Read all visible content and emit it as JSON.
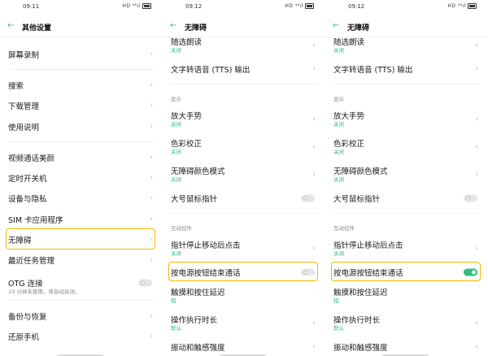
{
  "colors": {
    "accent": "#2dbe7d",
    "highlight": "#f5b800"
  },
  "panels": [
    {
      "time": "09:11",
      "status_icons": "HD ⁴⁶ıl",
      "title": "其他设置",
      "rows": [
        {
          "type": "item",
          "title": "屏幕录制",
          "control": "chevron"
        },
        {
          "type": "divider"
        },
        {
          "type": "item",
          "title": "搜索",
          "control": "chevron"
        },
        {
          "type": "item",
          "title": "下载管理",
          "control": "chevron"
        },
        {
          "type": "item",
          "title": "使用说明",
          "control": "chevron"
        },
        {
          "type": "divider"
        },
        {
          "type": "item",
          "title": "视频通话美颜",
          "control": "chevron"
        },
        {
          "type": "item",
          "title": "定时开关机",
          "control": "chevron"
        },
        {
          "type": "item",
          "title": "设备与隐私",
          "control": "chevron"
        },
        {
          "type": "item",
          "title": "SIM 卡应用程序",
          "control": "chevron"
        },
        {
          "type": "item",
          "title": "无障碍",
          "control": "chevron",
          "highlighted": true
        },
        {
          "type": "item",
          "title": "最近任务管理",
          "control": "chevron"
        },
        {
          "type": "item",
          "title": "OTG 连接",
          "subtitle": "10 分钟未使用，将自动关闭。",
          "subtitle_gray": true,
          "control": "toggle",
          "on": false
        },
        {
          "type": "divider"
        },
        {
          "type": "item",
          "title": "备份与恢复",
          "control": "chevron"
        },
        {
          "type": "item",
          "title": "还原手机",
          "control": "chevron"
        }
      ]
    },
    {
      "time": "09:12",
      "status_icons": "HD ⁴⁶ıl",
      "title": "无障碍",
      "rows": [
        {
          "type": "item",
          "title": "随选朗读",
          "subtitle": "关闭",
          "control": "chevron"
        },
        {
          "type": "item",
          "title": "文字转语音 (TTS) 输出",
          "control": "chevron"
        },
        {
          "type": "divider"
        },
        {
          "type": "section",
          "title": "显示"
        },
        {
          "type": "item",
          "title": "放大手势",
          "subtitle": "关闭",
          "control": "chevron"
        },
        {
          "type": "item",
          "title": "色彩校正",
          "subtitle": "关闭",
          "control": "chevron"
        },
        {
          "type": "item",
          "title": "无障碍颜色模式",
          "subtitle": "关闭",
          "control": "chevron"
        },
        {
          "type": "item",
          "title": "大号鼠标指针",
          "control": "toggle",
          "on": false
        },
        {
          "type": "divider"
        },
        {
          "type": "section",
          "title": "互动控件"
        },
        {
          "type": "item",
          "title": "指针停止移动后点击",
          "subtitle": "关闭",
          "control": "chevron"
        },
        {
          "type": "item",
          "title": "按电源按钮结束通话",
          "control": "toggle",
          "on": false,
          "highlighted": true
        },
        {
          "type": "item",
          "title": "触摸和按住延迟",
          "subtitle": "短",
          "control": "none"
        },
        {
          "type": "item",
          "title": "操作执行时长",
          "subtitle": "默认",
          "control": "chevron"
        },
        {
          "type": "item",
          "title": "振动和触感强度",
          "control": "chevron"
        }
      ]
    },
    {
      "time": "09:12",
      "status_icons": "HD ⁴⁶ıl",
      "title": "无障碍",
      "rows": [
        {
          "type": "item",
          "title": "随选朗读",
          "subtitle": "关闭",
          "control": "chevron"
        },
        {
          "type": "item",
          "title": "文字转语音 (TTS) 输出",
          "control": "chevron"
        },
        {
          "type": "divider"
        },
        {
          "type": "section",
          "title": "显示"
        },
        {
          "type": "item",
          "title": "放大手势",
          "subtitle": "关闭",
          "control": "chevron"
        },
        {
          "type": "item",
          "title": "色彩校正",
          "subtitle": "关闭",
          "control": "chevron"
        },
        {
          "type": "item",
          "title": "无障碍颜色模式",
          "subtitle": "关闭",
          "control": "chevron"
        },
        {
          "type": "item",
          "title": "大号鼠标指针",
          "control": "toggle",
          "on": false
        },
        {
          "type": "divider"
        },
        {
          "type": "section",
          "title": "互动控件"
        },
        {
          "type": "item",
          "title": "指针停止移动后点击",
          "subtitle": "关闭",
          "control": "chevron"
        },
        {
          "type": "item",
          "title": "按电源按钮结束通话",
          "control": "toggle",
          "on": true,
          "highlighted": true
        },
        {
          "type": "item",
          "title": "触摸和按住延迟",
          "subtitle": "短",
          "control": "none"
        },
        {
          "type": "item",
          "title": "操作执行时长",
          "subtitle": "默认",
          "control": "chevron"
        },
        {
          "type": "item",
          "title": "振动和触感强度",
          "control": "chevron"
        }
      ]
    }
  ]
}
